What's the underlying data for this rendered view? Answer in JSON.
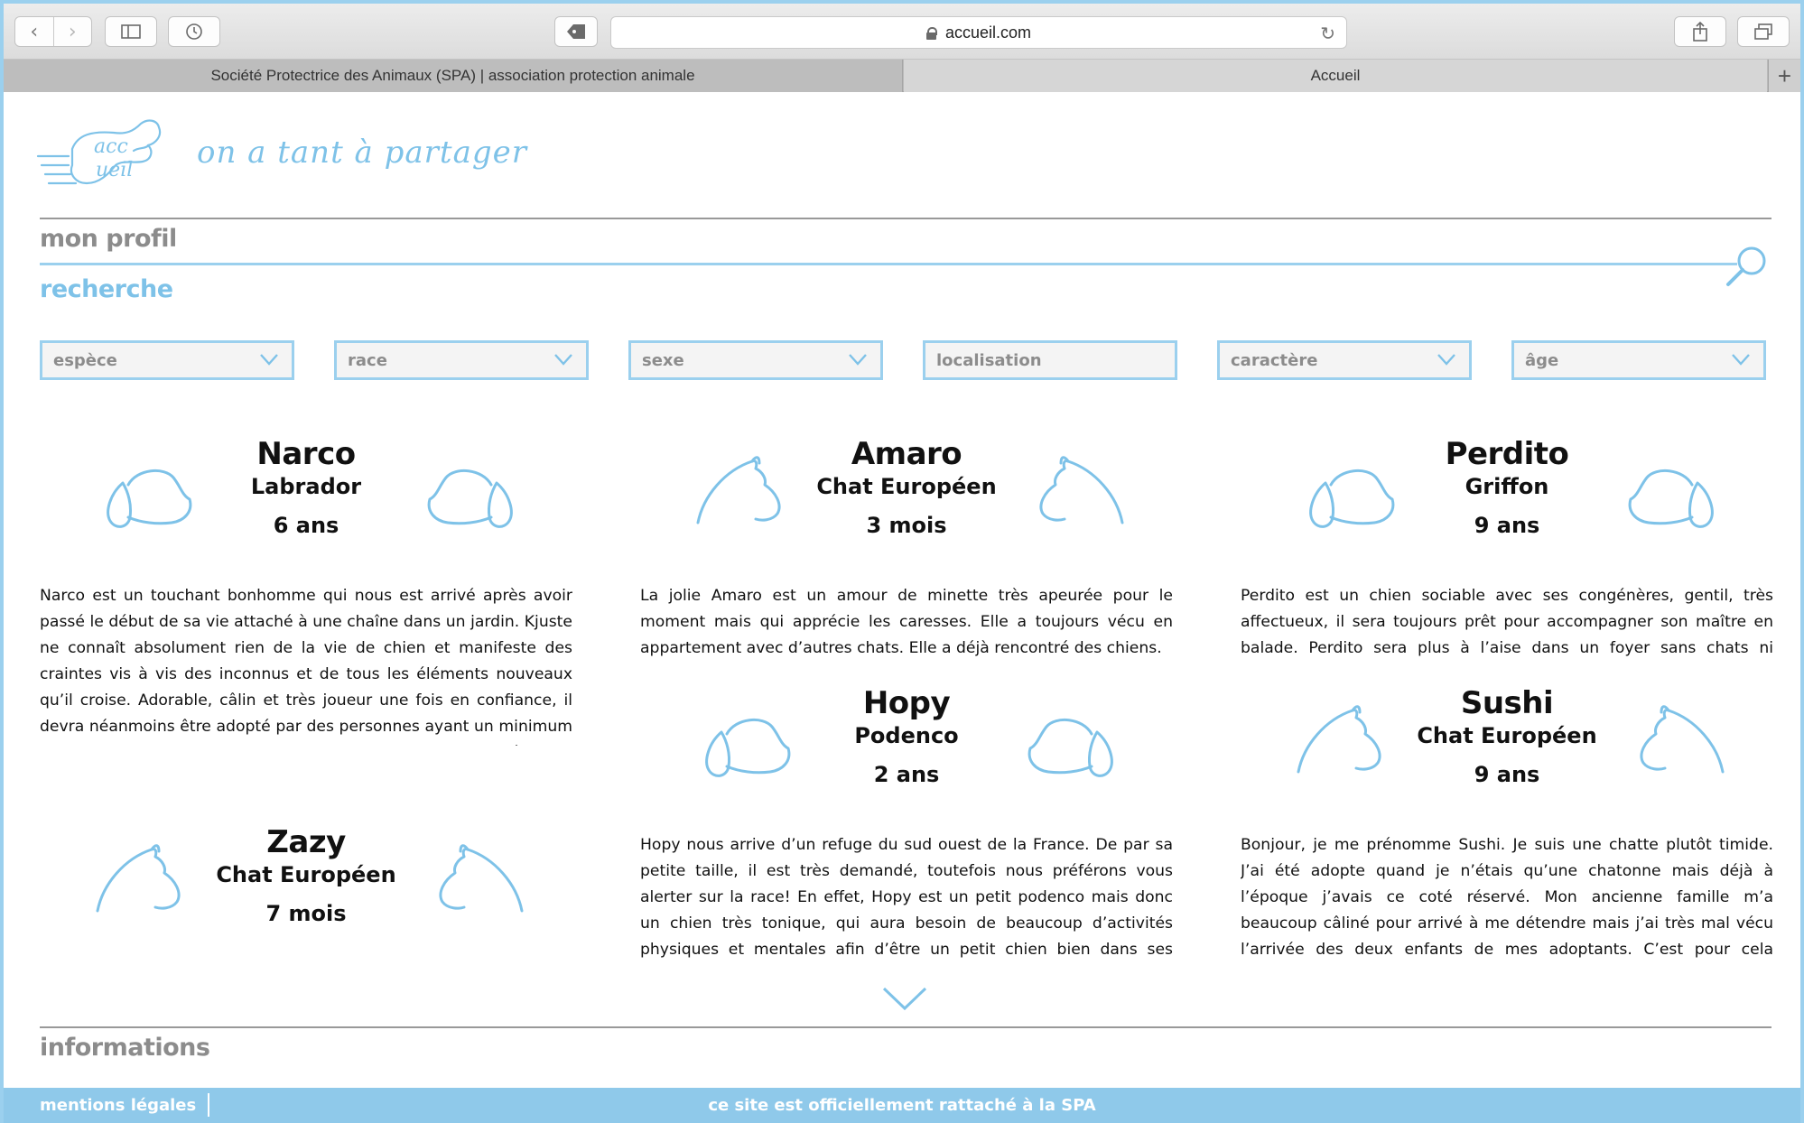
{
  "browser": {
    "url": "accueil.com",
    "tabs": [
      {
        "label": "Société Protectrice des Animaux (SPA) | association protection animale"
      },
      {
        "label": "Accueil"
      }
    ],
    "new_tab": "+"
  },
  "header": {
    "logo_line1": "acc",
    "logo_line2": "ueil",
    "slogan": "on a tant à partager"
  },
  "nav": {
    "profile": "mon profil",
    "search": "recherche",
    "info": "informations"
  },
  "filters": [
    {
      "label": "espèce",
      "dropdown": true
    },
    {
      "label": "race",
      "dropdown": true
    },
    {
      "label": "sexe",
      "dropdown": true
    },
    {
      "label": "localisation",
      "dropdown": false
    },
    {
      "label": "caractère",
      "dropdown": true
    },
    {
      "label": "âge",
      "dropdown": true
    }
  ],
  "animals": [
    {
      "name": "Narco",
      "breed": "Labrador",
      "age": "6 ans",
      "kind": "dog",
      "description": "Narco est un touchant bonhomme qui nous est arrivé après avoir passé le début de sa vie attaché à une chaîne dans un jardin. Kjuste ne connaît absolument rien de la vie de chien et manifeste des craintes vis à vis des inconnus et de tous les éléments nouveaux qu’il croise. Adorable, câlin et très joueur une fois en confiance, il devra néanmoins être adopté par des personnes ayant un minimum de connaissances canines et abordant les chiens en méthodes bienveillantes uniquement."
    },
    {
      "name": "Amaro",
      "breed": "Chat Européen",
      "age": "3 mois",
      "kind": "cat",
      "description": "La jolie Amaro est un amour de minette très apeurée pour le moment mais qui apprécie les caresses. Elle a toujours vécu en appartement avec d’autres chats. Elle a déjà rencontré des chiens."
    },
    {
      "name": "Perdito",
      "breed": "Griffon",
      "age": "9 ans",
      "kind": "dog",
      "description": "Perdito est un chien sociable avec ses congénères, gentil, très affectueux, il sera toujours prêt pour accompagner son maître en balade. Perdito sera plus à l’aise dans un foyer sans chats ni animaux de ferme."
    },
    {
      "name": "Zazy",
      "breed": "Chat Européen",
      "age": "7 mois",
      "kind": "cat",
      "description": ""
    },
    {
      "name": "Hopy",
      "breed": "Podenco",
      "age": "2 ans",
      "kind": "dog",
      "description": "Hopy nous arrive d’un refuge du sud ouest de la France. De par sa petite taille, il est très demandé, toutefois nous préférons vous alerter sur la race! En effet, Hopy est un petit podenco mais donc un chien très tonique, qui aura besoin de beaucoup d’activités physiques et mentales afin d’être un petit chien bien dans ses pattes. Il s’entend avec ses congénères mais"
    },
    {
      "name": "Sushi",
      "breed": "Chat Européen",
      "age": "9 ans",
      "kind": "cat",
      "description": "Bonjour, je me prénomme Sushi. Je suis une chatte plutôt timide. J’ai été adopte quand je n’étais qu’une chatonne mais déjà à l’époque j’avais ce coté réservé. Mon ancienne famille m’a beaucoup câliné pour arrivé à me détendre mais j’ai très mal vécu l’arrivée des deux enfants de mes adoptants. C’est pour cela qu’une famille sans enfants en bas age"
    }
  ],
  "footer": {
    "legal": "mentions légales",
    "official": "ce site est officiellement rattaché à la SPA"
  },
  "colors": {
    "accent": "#7ec2e8",
    "footer": "#8fc9ea",
    "muted": "#8c8c8c"
  }
}
